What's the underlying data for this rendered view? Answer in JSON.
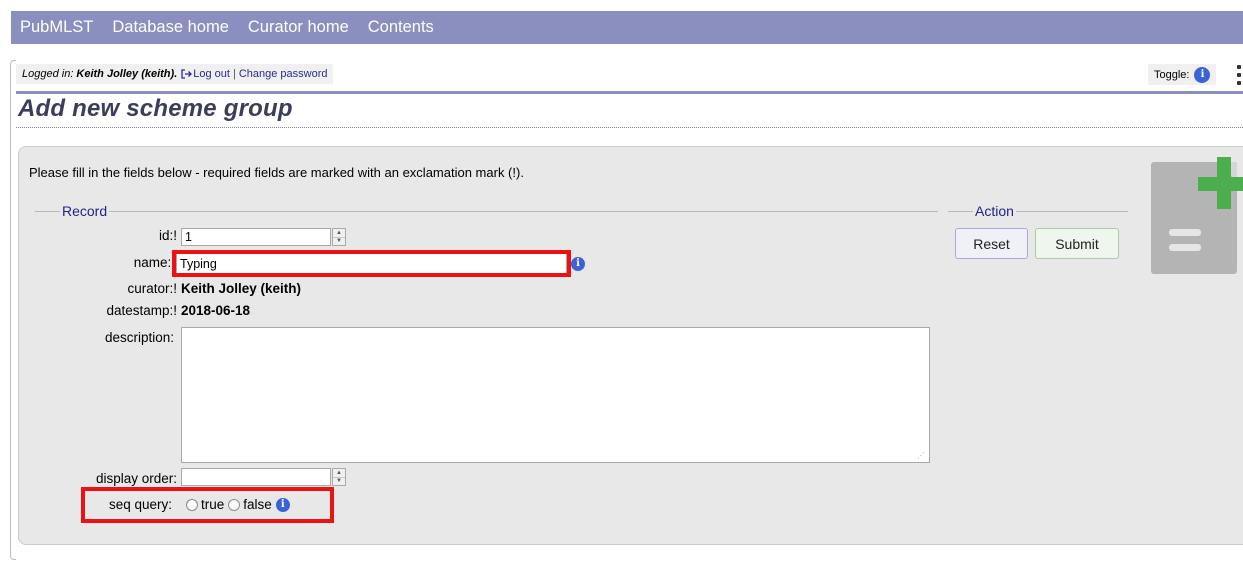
{
  "nav": {
    "items": [
      "PubMLST",
      "Database home",
      "Curator home",
      "Contents"
    ]
  },
  "login": {
    "prefix": "Logged in:",
    "user": "Keith Jolley (keith).",
    "logout": "Log out",
    "separator": "|",
    "change_password": "Change password"
  },
  "toggle": {
    "label": "Toggle:"
  },
  "page": {
    "title": "Add new scheme group"
  },
  "form": {
    "intro": "Please fill in the fields below - required fields are marked with an exclamation mark (!).",
    "record_legend": "Record",
    "action_legend": "Action",
    "fields": {
      "id": {
        "label": "id:!",
        "value": "1"
      },
      "name": {
        "label": "name:!",
        "value": "Typing"
      },
      "curator": {
        "label": "curator:!",
        "value": "Keith Jolley (keith)"
      },
      "datestamp": {
        "label": "datestamp:!",
        "value": "2018-06-18"
      },
      "description": {
        "label": "description:",
        "value": ""
      },
      "display_order": {
        "label": "display order:",
        "value": ""
      },
      "seq_query": {
        "label": "seq query:",
        "options": [
          "true",
          "false"
        ],
        "selected": null
      }
    },
    "buttons": {
      "reset": "Reset",
      "submit": "Submit"
    }
  },
  "colors": {
    "navbar": "#8a8fc0",
    "highlight": "#ee1111",
    "info": "#3a63d8",
    "add_icon": "#4cae4c"
  },
  "icons": {
    "logout": "sign-out-icon",
    "info": "info-icon",
    "add_record": "document-add-icon",
    "menu": "kebab-menu-icon"
  }
}
